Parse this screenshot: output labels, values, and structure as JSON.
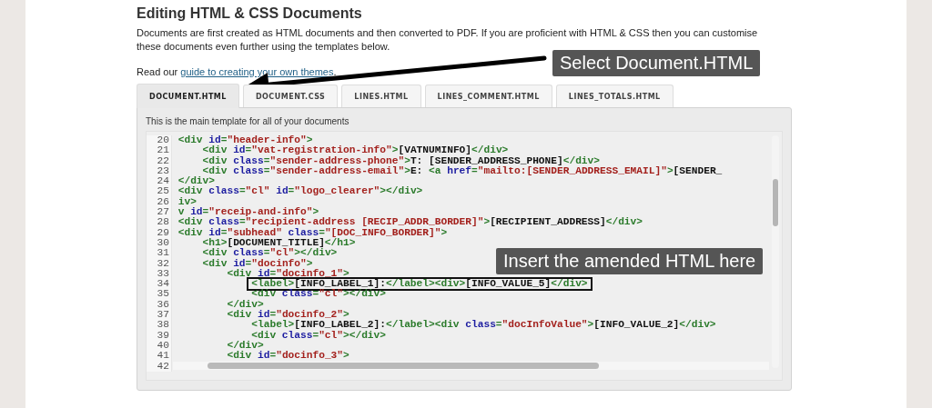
{
  "heading": "Editing HTML & CSS Documents",
  "intro": "Documents are first created as HTML documents and then converted to PDF. If you are proficient with HTML & CSS then you can customise these documents even further using the templates below.",
  "guide": {
    "prefix": "Read our ",
    "link": "guide to creating your own themes",
    "suffix": "."
  },
  "tabs": [
    {
      "label": "DOCUMENT.HTML",
      "selected": true
    },
    {
      "label": "DOCUMENT.CSS",
      "selected": false
    },
    {
      "label": "LINES.HTML",
      "selected": false
    },
    {
      "label": "LINES_COMMENT.HTML",
      "selected": false
    },
    {
      "label": "LINES_TOTALS.HTML",
      "selected": false
    }
  ],
  "panel_caption": "This is the main template for all of your documents",
  "code_lines": [
    {
      "number": "20",
      "boxed": false,
      "tokens": [
        {
          "kind": "tag",
          "text": "<div "
        },
        {
          "kind": "attr",
          "text": "id"
        },
        {
          "kind": "tag",
          "text": "="
        },
        {
          "kind": "string",
          "text": "\"header-info\""
        },
        {
          "kind": "tag",
          "text": ">"
        }
      ]
    },
    {
      "number": "21",
      "boxed": false,
      "tokens": [
        {
          "kind": "tag",
          "text": "    <div "
        },
        {
          "kind": "attr",
          "text": "id"
        },
        {
          "kind": "tag",
          "text": "="
        },
        {
          "kind": "string",
          "text": "\"vat-registration-info\""
        },
        {
          "kind": "tag",
          "text": ">"
        },
        {
          "kind": "text",
          "text": "[VATNUMINFO]"
        },
        {
          "kind": "tag",
          "text": "</div>"
        }
      ]
    },
    {
      "number": "22",
      "boxed": false,
      "tokens": [
        {
          "kind": "tag",
          "text": "    <div "
        },
        {
          "kind": "attr",
          "text": "class"
        },
        {
          "kind": "tag",
          "text": "="
        },
        {
          "kind": "string",
          "text": "\"sender-address-phone\""
        },
        {
          "kind": "tag",
          "text": ">"
        },
        {
          "kind": "text",
          "text": "T: [SENDER_ADDRESS_PHONE]"
        },
        {
          "kind": "tag",
          "text": "</div>"
        }
      ]
    },
    {
      "number": "23",
      "boxed": false,
      "tokens": [
        {
          "kind": "tag",
          "text": "    <div "
        },
        {
          "kind": "attr",
          "text": "class"
        },
        {
          "kind": "tag",
          "text": "="
        },
        {
          "kind": "string",
          "text": "\"sender-address-email\""
        },
        {
          "kind": "tag",
          "text": ">"
        },
        {
          "kind": "text",
          "text": "E: "
        },
        {
          "kind": "tag",
          "text": "<a "
        },
        {
          "kind": "attr",
          "text": "href"
        },
        {
          "kind": "tag",
          "text": "="
        },
        {
          "kind": "string",
          "text": "\"mailto:[SENDER_ADDRESS_EMAIL]\""
        },
        {
          "kind": "tag",
          "text": ">"
        },
        {
          "kind": "text",
          "text": "[SENDER_"
        }
      ]
    },
    {
      "number": "24",
      "boxed": false,
      "tokens": [
        {
          "kind": "tag",
          "text": "</div>"
        }
      ]
    },
    {
      "number": "25",
      "boxed": false,
      "tokens": [
        {
          "kind": "tag",
          "text": "<div "
        },
        {
          "kind": "attr",
          "text": "class"
        },
        {
          "kind": "tag",
          "text": "="
        },
        {
          "kind": "string",
          "text": "\"cl\" "
        },
        {
          "kind": "attr",
          "text": "id"
        },
        {
          "kind": "tag",
          "text": "="
        },
        {
          "kind": "string",
          "text": "\"logo_clearer\""
        },
        {
          "kind": "tag",
          "text": "></div>"
        }
      ]
    },
    {
      "number": "26",
      "boxed": false,
      "tokens": [
        {
          "kind": "tag",
          "text": "iv>"
        }
      ]
    },
    {
      "number": "27",
      "boxed": false,
      "tokens": [
        {
          "kind": "tag",
          "text": "v "
        },
        {
          "kind": "attr",
          "text": "id"
        },
        {
          "kind": "tag",
          "text": "="
        },
        {
          "kind": "string",
          "text": "\"receip-and-info\""
        },
        {
          "kind": "tag",
          "text": ">"
        }
      ]
    },
    {
      "number": "28",
      "boxed": false,
      "tokens": [
        {
          "kind": "tag",
          "text": "<div "
        },
        {
          "kind": "attr",
          "text": "class"
        },
        {
          "kind": "tag",
          "text": "="
        },
        {
          "kind": "string",
          "text": "\"recipient-address [RECIP_ADDR_BORDER]\""
        },
        {
          "kind": "tag",
          "text": ">"
        },
        {
          "kind": "text",
          "text": "[RECIPIENT_ADDRESS]"
        },
        {
          "kind": "tag",
          "text": "</div>"
        }
      ]
    },
    {
      "number": "29",
      "boxed": false,
      "tokens": [
        {
          "kind": "tag",
          "text": "<div "
        },
        {
          "kind": "attr",
          "text": "id"
        },
        {
          "kind": "tag",
          "text": "="
        },
        {
          "kind": "string",
          "text": "\"subhead\" "
        },
        {
          "kind": "attr",
          "text": "class"
        },
        {
          "kind": "tag",
          "text": "="
        },
        {
          "kind": "string",
          "text": "\"[DOC_INFO_BORDER]\""
        },
        {
          "kind": "tag",
          "text": ">"
        }
      ]
    },
    {
      "number": "30",
      "boxed": false,
      "tokens": [
        {
          "kind": "tag",
          "text": "    <h1>"
        },
        {
          "kind": "text",
          "text": "[DOCUMENT_TITLE]"
        },
        {
          "kind": "tag",
          "text": "</h1>"
        }
      ]
    },
    {
      "number": "31",
      "boxed": false,
      "tokens": [
        {
          "kind": "tag",
          "text": "    <div "
        },
        {
          "kind": "attr",
          "text": "class"
        },
        {
          "kind": "tag",
          "text": "="
        },
        {
          "kind": "string",
          "text": "\"cl\""
        },
        {
          "kind": "tag",
          "text": "></div>"
        }
      ]
    },
    {
      "number": "32",
      "boxed": false,
      "tokens": [
        {
          "kind": "tag",
          "text": "    <div "
        },
        {
          "kind": "attr",
          "text": "id"
        },
        {
          "kind": "tag",
          "text": "="
        },
        {
          "kind": "string",
          "text": "\"docinfo\""
        },
        {
          "kind": "tag",
          "text": ">"
        }
      ]
    },
    {
      "number": "33",
      "boxed": false,
      "tokens": [
        {
          "kind": "tag",
          "text": "        <div "
        },
        {
          "kind": "attr",
          "text": "id"
        },
        {
          "kind": "tag",
          "text": "="
        },
        {
          "kind": "string",
          "text": "\"docinfo_1\""
        },
        {
          "kind": "tag",
          "text": ">"
        }
      ]
    },
    {
      "number": "34",
      "boxed": true,
      "tokens": [
        {
          "kind": "tag",
          "text": "            <label>"
        },
        {
          "kind": "text",
          "text": "[INFO_LABEL_1]:"
        },
        {
          "kind": "tag",
          "text": "</label><div>"
        },
        {
          "kind": "text",
          "text": "[INFO_VALUE_5]"
        },
        {
          "kind": "tag",
          "text": "</div>"
        }
      ]
    },
    {
      "number": "35",
      "boxed": false,
      "tokens": [
        {
          "kind": "tag",
          "text": "            <div "
        },
        {
          "kind": "attr",
          "text": "class"
        },
        {
          "kind": "tag",
          "text": "="
        },
        {
          "kind": "string",
          "text": "\"cl\""
        },
        {
          "kind": "tag",
          "text": "></div>"
        }
      ]
    },
    {
      "number": "36",
      "boxed": false,
      "tokens": [
        {
          "kind": "tag",
          "text": "        </div>"
        }
      ]
    },
    {
      "number": "37",
      "boxed": false,
      "tokens": [
        {
          "kind": "tag",
          "text": "        <div "
        },
        {
          "kind": "attr",
          "text": "id"
        },
        {
          "kind": "tag",
          "text": "="
        },
        {
          "kind": "string",
          "text": "\"docinfo_2\""
        },
        {
          "kind": "tag",
          "text": ">"
        }
      ]
    },
    {
      "number": "38",
      "boxed": false,
      "tokens": [
        {
          "kind": "tag",
          "text": "            <label>"
        },
        {
          "kind": "text",
          "text": "[INFO_LABEL_2]:"
        },
        {
          "kind": "tag",
          "text": "</label><div "
        },
        {
          "kind": "attr",
          "text": "class"
        },
        {
          "kind": "tag",
          "text": "="
        },
        {
          "kind": "string",
          "text": "\"docInfoValue\""
        },
        {
          "kind": "tag",
          "text": ">"
        },
        {
          "kind": "text",
          "text": "[INFO_VALUE_2]"
        },
        {
          "kind": "tag",
          "text": "</div>"
        }
      ]
    },
    {
      "number": "39",
      "boxed": false,
      "tokens": [
        {
          "kind": "tag",
          "text": "            <div "
        },
        {
          "kind": "attr",
          "text": "class"
        },
        {
          "kind": "tag",
          "text": "="
        },
        {
          "kind": "string",
          "text": "\"cl\""
        },
        {
          "kind": "tag",
          "text": "></div>"
        }
      ]
    },
    {
      "number": "40",
      "boxed": false,
      "tokens": [
        {
          "kind": "tag",
          "text": "        </div>"
        }
      ]
    },
    {
      "number": "41",
      "boxed": false,
      "tokens": [
        {
          "kind": "tag",
          "text": "        <div "
        },
        {
          "kind": "attr",
          "text": "id"
        },
        {
          "kind": "tag",
          "text": "="
        },
        {
          "kind": "string",
          "text": "\"docinfo_3\""
        },
        {
          "kind": "tag",
          "text": ">"
        }
      ]
    },
    {
      "number": "42"
    }
  ],
  "callouts": [
    {
      "text": "Select Document.HTML"
    },
    {
      "text": "Insert the amended HTML here"
    }
  ]
}
